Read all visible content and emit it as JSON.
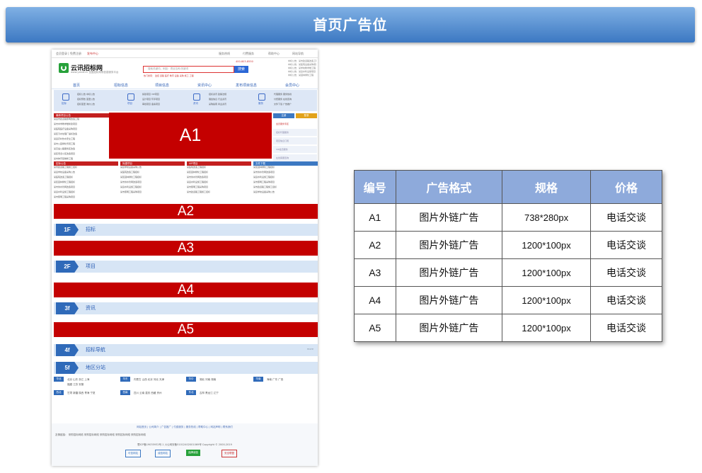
{
  "page": {
    "title": "首页广告位"
  },
  "site": {
    "topbar": {
      "left": "会员登录 | 免费注册",
      "left2": "发布中心",
      "links": [
        "服务热线",
        "付费服务",
        "帮助中心",
        "网站导航"
      ]
    },
    "logo": {
      "name": "云讯招标网",
      "domain": "www.yxbid.cn",
      "sub": "全国招标采购信息服务平台"
    },
    "search": {
      "placeholder": "搜索关键词，例如：项目名称/关键词",
      "button": "搜索",
      "hot": "热门搜索：  监控  道路  医疗  教育  设备  采购  施工  工程"
    },
    "hotline": "400-803-8550",
    "right_news": [
      "中标公告：某市政道路改造工程",
      "中标公告：某医院设备采购项目",
      "中标公告：某学校教学楼工程",
      "中标公告：某县水利设施项目",
      "中标公告：某园林绿化工程"
    ],
    "nav": [
      "首页",
      "招标信息",
      "项目信息",
      "资讯中心",
      "发布项目信息",
      "会员中心"
    ],
    "categories": [
      {
        "label": "招标",
        "lines": [
          "招标公告  中标公告",
          "招标预告  变更公告",
          "招标变更  询价公告"
        ]
      },
      {
        "label": "项目",
        "lines": [
          "拟建项目  VIP项目",
          "设计项目  环评项目",
          "审批项目  备案项目"
        ]
      },
      {
        "label": "资讯",
        "lines": [
          "招标资讯  政策法规",
          "展会信息  行业资讯",
          "采购指南  商业资讯"
        ]
      },
      {
        "label": "服务",
        "lines": [
          "代理服务  服务热线",
          "付费服务  在线咨询",
          "文件下载  广告推广"
        ]
      }
    ],
    "latest": {
      "head": "最新项目公告",
      "items": [
        "某县市政道路照明改造工程",
        "某市中学教学楼新建项目",
        "某医院医疗设备采购项目",
        "某区污水处理厂提标改造",
        "某县农村饮水安全工程",
        "某市公园绿化景观工程",
        "某高速公路服务区改造",
        "某区老旧小区改造项目",
        "某市体育馆维修工程"
      ]
    },
    "side": {
      "tabs": [
        "注册",
        "登录"
      ],
      "items": [
        "会员服务专区",
        "招标代理服务",
        "项目信息订阅",
        "VIP会员服务",
        "在线客服咨询"
      ]
    },
    "grid_heads": [
      "招标公告",
      "拟建项目",
      "VIP项目",
      "文件下载"
    ],
    "grid_items": [
      "某市政道路工程施工招标",
      "某县学校设备采购公告",
      "某医院改造工程招标",
      "某区园林绿化工程招标",
      "某市供水管网改造项目",
      "某县水利设施工程招标",
      "某市照明工程采购项目"
    ],
    "ads": [
      "A1",
      "A2",
      "A3",
      "A4",
      "A5"
    ],
    "floors": [
      {
        "tag": "1F",
        "label": "招标",
        "more": ""
      },
      {
        "tag": "2F",
        "label": "项目",
        "more": ""
      },
      {
        "tag": "3f",
        "label": "资讯",
        "more": ""
      },
      {
        "tag": "4f",
        "label": "招标导航",
        "more": "more"
      },
      {
        "tag": "5f",
        "label": "地区分站",
        "more": ""
      }
    ],
    "regions": [
      {
        "tag": "华北",
        "txt": "北京  山东  浙江  上海"
      },
      {
        "tag": "华东",
        "txt": "内蒙古  山西  北京  河北  天津"
      },
      {
        "tag": "华中",
        "txt": "湖北  河南  湖南"
      },
      {
        "tag": "华南",
        "txt": "海南  广东  广西"
      },
      {
        "tag": "华东",
        "txt": "福建  江苏  安徽"
      },
      {
        "tag": "西北",
        "txt": "甘肃  新疆  陕西  青海  宁夏"
      },
      {
        "tag": "西南",
        "txt": "四川  云南  重庆  西藏  贵州"
      },
      {
        "tag": "东北",
        "txt": "吉林  黑龙江  辽宁"
      }
    ],
    "footer": {
      "links": "网站首页  |  公司简介  |  广告推广  |  付费服务  |  服务热线  |  帮助中心  |  网站声明  |  联系我们",
      "friends": "友情链接：   采购招标网络   采购招标网络   采购招标网络   采购招标网络   采购招标网络",
      "copy": "蜀ICP备19035932号-1  川公网安备51012402001069号  Copyright © 2000-2019",
      "badges": [
        "可信网站",
        "诚信网站",
        "品牌诚信",
        "安全联盟"
      ]
    }
  },
  "price_table": {
    "headers": [
      "编号",
      "广告格式",
      "规格",
      "价格"
    ],
    "rows": [
      [
        "A1",
        "图片外链广告",
        "738*280px",
        "电话交谈"
      ],
      [
        "A2",
        "图片外链广告",
        "1200*100px",
        "电话交谈"
      ],
      [
        "A3",
        "图片外链广告",
        "1200*100px",
        "电话交谈"
      ],
      [
        "A4",
        "图片外链广告",
        "1200*100px",
        "电话交谈"
      ],
      [
        "A5",
        "图片外链广告",
        "1200*100px",
        "电话交谈"
      ]
    ]
  },
  "colors": {
    "header_top": "#7fb0e4",
    "header_bottom": "#3c78c2",
    "ad_red": "#c40000",
    "table_head": "#8eaadb",
    "floor_blue": "#2f6ab9"
  }
}
